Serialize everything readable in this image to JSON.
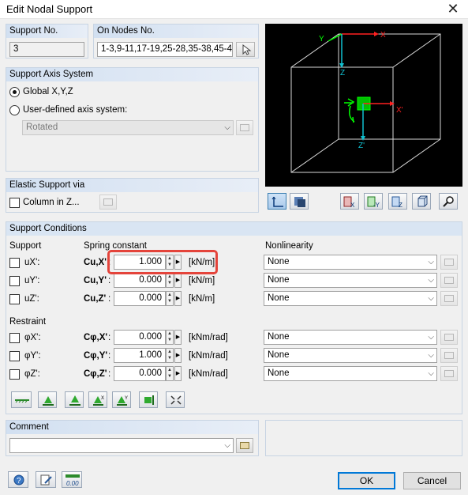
{
  "window": {
    "title": "Edit Nodal Support"
  },
  "support_no": {
    "label": "Support No.",
    "value": "3"
  },
  "on_nodes": {
    "label": "On Nodes No.",
    "value": "1-3,9-11,17-19,25-28,35-38,45-4"
  },
  "axis_system": {
    "heading": "Support Axis System",
    "global_label": "Global X,Y,Z",
    "user_label": "User-defined axis system:",
    "combo_value": "Rotated"
  },
  "elastic": {
    "heading": "Elastic Support via",
    "column_label": "Column in Z..."
  },
  "preview": {
    "axes": {
      "x_top": "X",
      "y_top": "Y",
      "z_top": "Z",
      "x_center": "X'",
      "z_center": "Z'"
    }
  },
  "conditions": {
    "heading": "Support Conditions",
    "col_support": "Support",
    "col_spring": "Spring constant",
    "col_nonlin": "Nonlinearity",
    "restraint_label": "Restraint",
    "rows": [
      {
        "check": "uX':",
        "sym": "Cu,X'",
        "colon": ":",
        "value": "1.000",
        "unit": "[kN/m]",
        "nonlin": "None"
      },
      {
        "check": "uY':",
        "sym": "Cu,Y'",
        "colon": ":",
        "value": "0.000",
        "unit": "[kN/m]",
        "nonlin": "None"
      },
      {
        "check": "uZ':",
        "sym": "Cu,Z'",
        "colon": ":",
        "value": "0.000",
        "unit": "[kN/m]",
        "nonlin": "None"
      },
      {
        "check": "φX':",
        "sym": "Cφ,X'",
        "colon": ":",
        "value": "0.000",
        "unit": "[kNm/rad]",
        "nonlin": "None"
      },
      {
        "check": "φY':",
        "sym": "Cφ,Y'",
        "colon": ":",
        "value": "1.000",
        "unit": "[kNm/rad]",
        "nonlin": "None"
      },
      {
        "check": "φZ':",
        "sym": "Cφ,Z'",
        "colon": ":",
        "value": "0.000",
        "unit": "[kNm/rad]",
        "nonlin": "None"
      }
    ]
  },
  "comment": {
    "heading": "Comment",
    "value": ""
  },
  "footer": {
    "ok_label": "OK",
    "cancel_label": "Cancel",
    "units_icon_text": "0.00"
  },
  "colors": {
    "group_header": "#d9e5f3",
    "highlight": "#e4443b",
    "preview_bg": "#000000",
    "axis_green": "#00ff00",
    "axis_red": "#ff2020",
    "axis_cyan": "#10c0d0"
  }
}
